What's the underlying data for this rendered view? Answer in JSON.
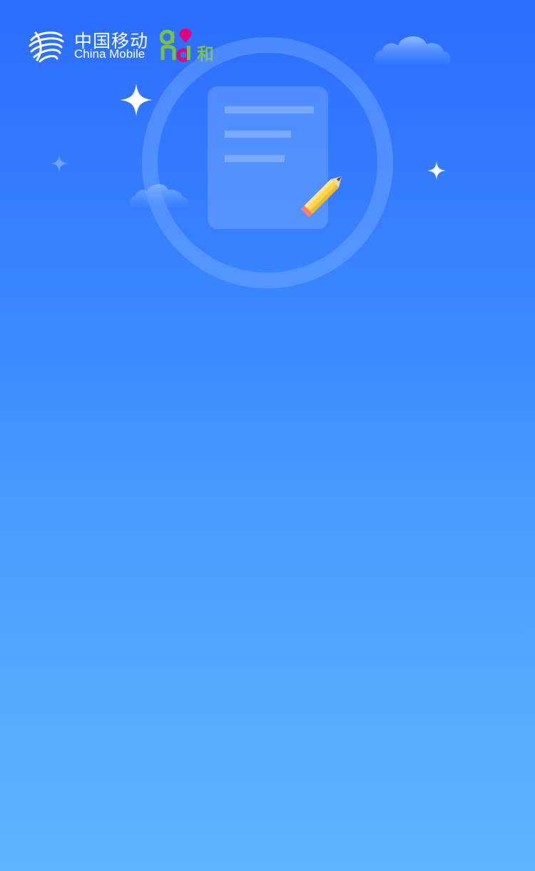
{
  "header": {
    "brand_name_cn": "中国移动",
    "brand_name_en": "China Mobile",
    "sub_brand_mark": "and和"
  },
  "hero": {
    "icon": "document-with-pencil-icon",
    "decorations": [
      "cloud-icon",
      "sparkle-icon"
    ]
  },
  "colors": {
    "background_top": "#2b6cff",
    "background_bottom": "#5db6ff",
    "sub_brand_green": "#7ac143",
    "sub_brand_magenta": "#e0007a",
    "pencil_yellow": "#ffd54a"
  }
}
